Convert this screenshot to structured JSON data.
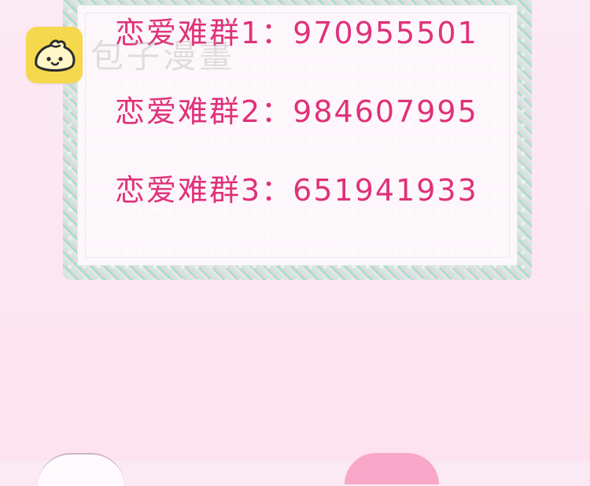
{
  "watermark": {
    "text": "包子漫畫"
  },
  "groups": [
    {
      "label": "恋爱难群1：970955501"
    },
    {
      "label": "恋爱难群2：984607995"
    },
    {
      "label": "恋爱难群3：651941933"
    }
  ],
  "colors": {
    "text_pink": "#e0317a",
    "lace_green": "#a8e2c6",
    "lace_pink": "#e7d4e6",
    "background": "#fbe9f3",
    "logo_yellow": "#f6d84e"
  }
}
